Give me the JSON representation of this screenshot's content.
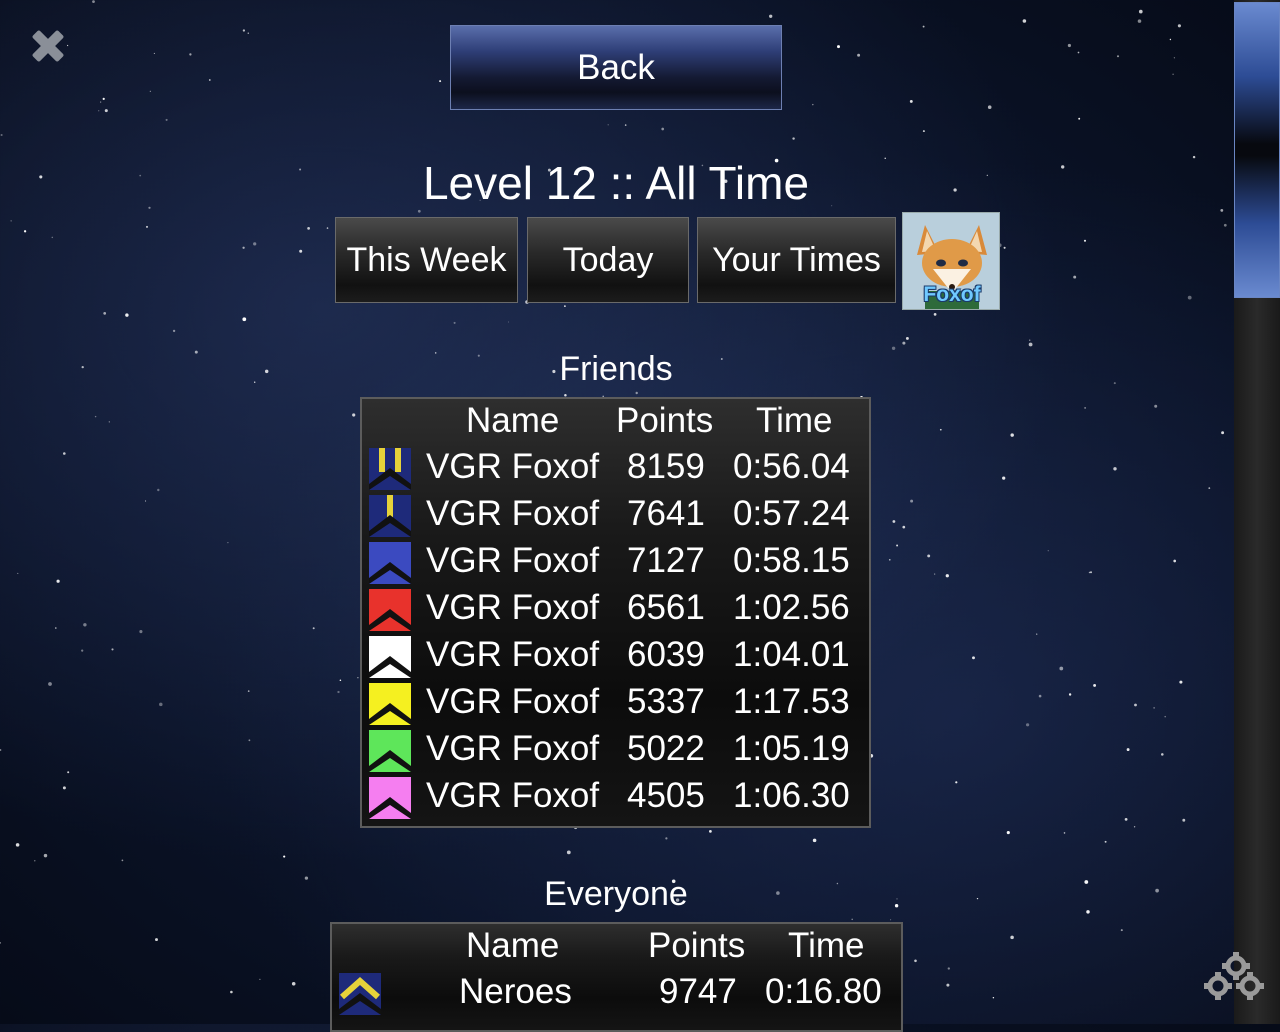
{
  "header": {
    "back_label": "Back",
    "title": "Level 12 :: All Time"
  },
  "tabs": [
    {
      "label": "This Week"
    },
    {
      "label": "Today"
    },
    {
      "label": "Your Times"
    }
  ],
  "avatar": {
    "name": "Foxof"
  },
  "friends": {
    "label": "Friends",
    "columns": {
      "name": "Name",
      "points": "Points",
      "time": "Time"
    },
    "rows": [
      {
        "badge": "navy-gold-stripes",
        "name": "VGR Foxof",
        "points": "8159",
        "time": "0:56.04"
      },
      {
        "badge": "navy-gold-single-stripe",
        "name": "VGR Foxof",
        "points": "7641",
        "time": "0:57.24"
      },
      {
        "badge": "blue",
        "name": "VGR Foxof",
        "points": "7127",
        "time": "0:58.15"
      },
      {
        "badge": "red",
        "name": "VGR Foxof",
        "points": "6561",
        "time": "1:02.56"
      },
      {
        "badge": "white",
        "name": "VGR Foxof",
        "points": "6039",
        "time": "1:04.01"
      },
      {
        "badge": "yellow",
        "name": "VGR Foxof",
        "points": "5337",
        "time": "1:17.53"
      },
      {
        "badge": "green",
        "name": "VGR Foxof",
        "points": "5022",
        "time": "1:05.19"
      },
      {
        "badge": "pink",
        "name": "VGR Foxof",
        "points": "4505",
        "time": "1:06.30"
      }
    ]
  },
  "everyone": {
    "label": "Everyone",
    "columns": {
      "name": "Name",
      "points": "Points",
      "time": "Time"
    },
    "rows": [
      {
        "badge": "navy-gold-chevron",
        "name": "Neroes",
        "points": "9747",
        "time": "0:16.80"
      }
    ]
  },
  "colors": {
    "back_button_top": "#5a6eab",
    "scroll_thumb": "#2d4c95",
    "badge_navy": "#1e2a7a",
    "badge_gold": "#e6d23a",
    "badge_blue": "#3b4ac0",
    "badge_red": "#e8322c",
    "badge_white": "#ffffff",
    "badge_yellow": "#f5f020",
    "badge_green": "#5ee65a",
    "badge_pink": "#f57ef0"
  },
  "icons": [
    "close-icon",
    "gear-icon",
    "rank-badge-icon"
  ]
}
